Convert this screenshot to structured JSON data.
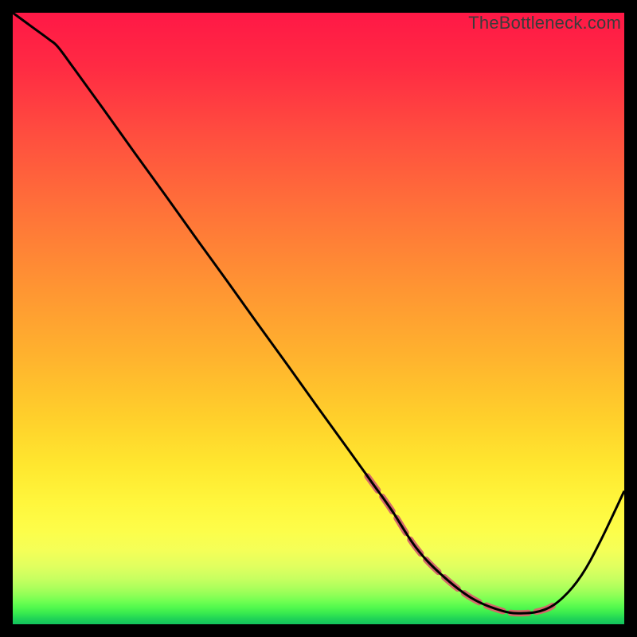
{
  "watermark": "TheBottleneck.com",
  "chart_data": {
    "type": "line",
    "title": "",
    "xlabel": "",
    "ylabel": "",
    "xlim": [
      0,
      1
    ],
    "ylim": [
      0,
      1
    ],
    "series": [
      {
        "name": "curve",
        "stroke": "#000000",
        "stroke_width": 3,
        "x": [
          0.0,
          0.03,
          0.06,
          0.074,
          0.1,
          0.15,
          0.2,
          0.25,
          0.3,
          0.35,
          0.4,
          0.45,
          0.5,
          0.55,
          0.588,
          0.62,
          0.659,
          0.7,
          0.75,
          0.8,
          0.835,
          0.87,
          0.9,
          0.93,
          0.96,
          1.0
        ],
        "y": [
          1.0,
          0.978,
          0.956,
          0.944,
          0.909,
          0.84,
          0.77,
          0.701,
          0.631,
          0.562,
          0.492,
          0.423,
          0.353,
          0.284,
          0.231,
          0.186,
          0.126,
          0.082,
          0.043,
          0.022,
          0.018,
          0.024,
          0.044,
          0.08,
          0.134,
          0.218
        ]
      },
      {
        "name": "dashed-segment",
        "stroke": "#d46a6a",
        "stroke_width": 8,
        "dash": "22 10",
        "linecap": "round",
        "x": [
          0.58,
          0.618,
          0.659,
          0.7,
          0.75,
          0.8,
          0.835,
          0.87,
          0.89
        ],
        "y": [
          0.242,
          0.189,
          0.126,
          0.082,
          0.043,
          0.022,
          0.018,
          0.024,
          0.035
        ]
      }
    ],
    "gradient_stops": [
      {
        "offset": 0.0,
        "color": "#ff1846"
      },
      {
        "offset": 0.09,
        "color": "#ff2b43"
      },
      {
        "offset": 0.2,
        "color": "#ff4e3f"
      },
      {
        "offset": 0.32,
        "color": "#ff7139"
      },
      {
        "offset": 0.44,
        "color": "#ff9233"
      },
      {
        "offset": 0.56,
        "color": "#ffb22e"
      },
      {
        "offset": 0.66,
        "color": "#ffcf2b"
      },
      {
        "offset": 0.74,
        "color": "#ffe72f"
      },
      {
        "offset": 0.8,
        "color": "#fff63c"
      },
      {
        "offset": 0.845,
        "color": "#fdfd49"
      },
      {
        "offset": 0.88,
        "color": "#f4ff58"
      },
      {
        "offset": 0.905,
        "color": "#e1ff5f"
      },
      {
        "offset": 0.925,
        "color": "#c8ff60"
      },
      {
        "offset": 0.94,
        "color": "#adff5c"
      },
      {
        "offset": 0.952,
        "color": "#90ff57"
      },
      {
        "offset": 0.962,
        "color": "#72ff52"
      },
      {
        "offset": 0.972,
        "color": "#53f94e"
      },
      {
        "offset": 0.982,
        "color": "#38ea4f"
      },
      {
        "offset": 0.99,
        "color": "#22d656"
      },
      {
        "offset": 1.0,
        "color": "#12c25d"
      }
    ]
  }
}
